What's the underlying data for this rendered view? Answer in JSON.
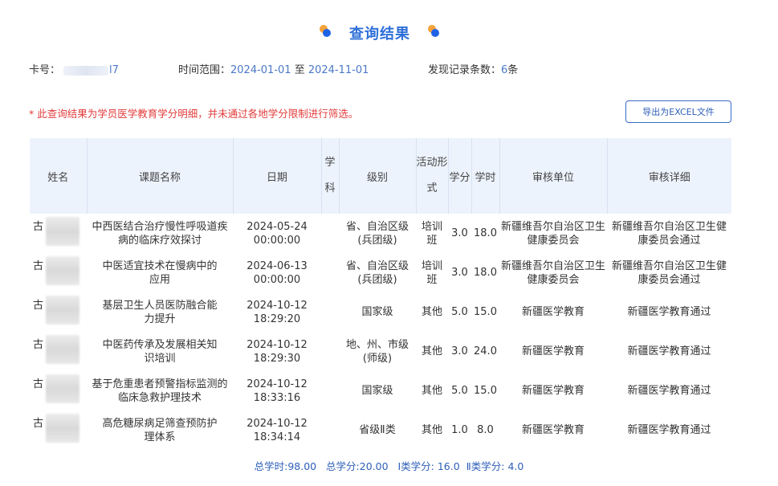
{
  "header": {
    "title": "查询结果",
    "accent_color": "#2f6fd8",
    "dot_colors": [
      "#f5a23a",
      "#1e63e6"
    ]
  },
  "meta": {
    "card_label": "卡号：",
    "card_suffix": "l7",
    "range_label": "时间范围：",
    "range_start": "2024-01-01",
    "range_sep": " 至 ",
    "range_end": "2024-11-01",
    "count_label": "发现记录条数：",
    "count_value": "6",
    "count_unit": "条"
  },
  "notice": "* 此查询结果为学员医学教育学分明细，并未通过各地学分限制进行筛选。",
  "export_button": "导出为EXCEL文件",
  "table": {
    "headers": {
      "name": "姓名",
      "course": "课题名称",
      "date": "日期",
      "subject_1": "学",
      "subject_2": "科",
      "level": "级别",
      "activity_1": "活动形",
      "activity_2": "式",
      "credit": "学分",
      "hours": "学时",
      "review_unit": "审核单位",
      "review_detail": "审核详细"
    },
    "rows": [
      {
        "name": "古",
        "course": "中西医结合治疗慢性呼吸道疾病的临床疗效探讨",
        "date": "2024-05-24 00:00:00",
        "subject": "",
        "level": "省、自治区级(兵团级)",
        "activity": "培训班",
        "credit": "3.0",
        "hours": "18.0",
        "review_unit": "新疆维吾尔自治区卫生健康委员会",
        "review_detail": "新疆维吾尔自治区卫生健康委员会通过"
      },
      {
        "name": "古",
        "course": "中医适宜技术在慢病中的应用",
        "date": "2024-06-13 00:00:00",
        "subject": "",
        "level": "省、自治区级(兵团级)",
        "activity": "培训班",
        "credit": "3.0",
        "hours": "18.0",
        "review_unit": "新疆维吾尔自治区卫生健康委员会",
        "review_detail": "新疆维吾尔自治区卫生健康委员会通过"
      },
      {
        "name": "古",
        "course": "基层卫生人员医防融合能力提升",
        "date": "2024-10-12 18:29:20",
        "subject": "",
        "level": "国家级",
        "activity": "其他",
        "credit": "5.0",
        "hours": "15.0",
        "review_unit": "新疆医学教育",
        "review_detail": "新疆医学教育通过"
      },
      {
        "name": "古",
        "course": "中医药传承及发展相关知识培训",
        "date": "2024-10-12 18:29:30",
        "subject": "",
        "level": "地、州、市级(师级)",
        "activity": "其他",
        "credit": "3.0",
        "hours": "24.0",
        "review_unit": "新疆医学教育",
        "review_detail": "新疆医学教育通过"
      },
      {
        "name": "古",
        "course": "基于危重患者预警指标监测的临床急救护理技术",
        "date": "2024-10-12 18:33:16",
        "subject": "",
        "level": "国家级",
        "activity": "其他",
        "credit": "5.0",
        "hours": "15.0",
        "review_unit": "新疆医学教育",
        "review_detail": "新疆医学教育通过"
      },
      {
        "name": "古",
        "course": "高危糖尿病足筛查预防护理体系",
        "date": "2024-10-12 18:34:14",
        "subject": "",
        "level": "省级Ⅱ类",
        "activity": "其他",
        "credit": "1.0",
        "hours": "8.0",
        "review_unit": "新疆医学教育",
        "review_detail": "新疆医学教育通过"
      }
    ]
  },
  "summary": "总学时:98.00   总学分:20.00   Ⅰ类学分: 16.0  Ⅱ类学分: 4.0"
}
